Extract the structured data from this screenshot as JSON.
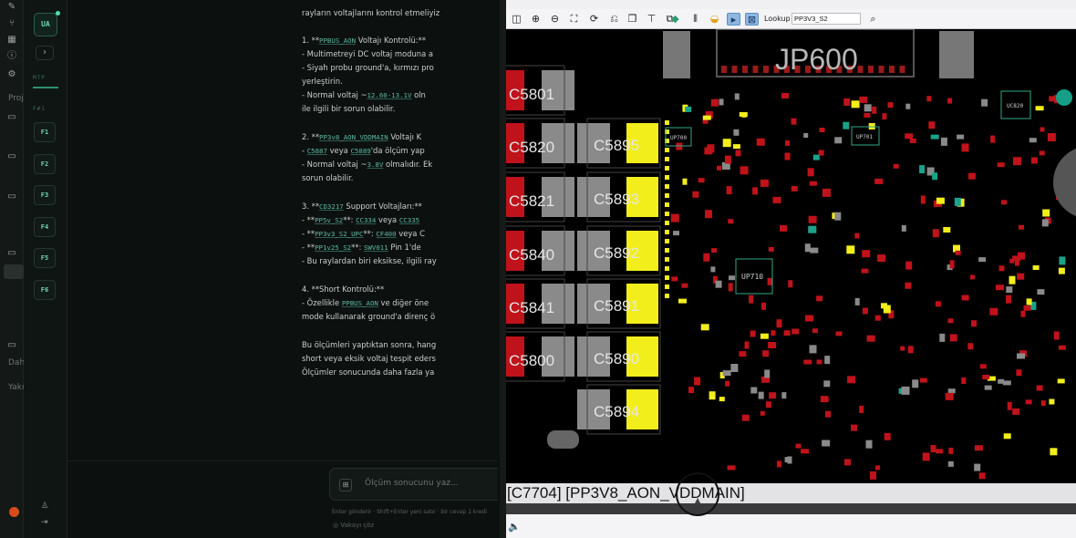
{
  "sys_strip": {
    "labels": [
      "Proj",
      "Dah",
      "Yakı"
    ]
  },
  "fkey_sidebar": {
    "badge": "UA",
    "group_top": "MTP",
    "group_f": "F#1",
    "keys": [
      "F1",
      "F2",
      "F3",
      "F4",
      "F5",
      "F6"
    ]
  },
  "chat": {
    "lines_intro": "rayların voltajlarını kontrol etmeliyiz",
    "s1_title_pre": "1. **",
    "s1_code": "PPBUS_AON",
    "s1_title_post": " Voltajı Kontrolü:**",
    "s1_l1": "- Multimetreyi DC voltaj moduna a",
    "s1_l2": "- Siyah probu ground'a, kırmızı pro",
    "s1_l3": "yerleştirin.",
    "s1_l4_pre": "- Normal voltaj ~",
    "s1_l4_code": "12.60-13.1V",
    "s1_l4_post": " oln",
    "s1_l5": "ile ilgili bir sorun olabilir.",
    "s2_title_pre": "2. **",
    "s2_code": "PP3v8_AON_VDDMAIN",
    "s2_title_post": " Voltajı K",
    "s2_l1_pre": "- ",
    "s2_l1_code1": "C5887",
    "s2_l1_mid": " veya ",
    "s2_l1_code2": "C5889",
    "s2_l1_post": "'da ölçüm yap",
    "s2_l2_pre": "- Normal voltaj ~",
    "s2_l2_code": "3.8V",
    "s2_l2_post": " olmalıdır. Ek",
    "s2_l3": "sorun olabilir.",
    "s3_title_pre": "3. **",
    "s3_code": "CD3217",
    "s3_title_post": " Support Voltajları:**",
    "s3_l1_pre": "- **",
    "s3_l1_code1": "PP5v_S2",
    "s3_l1_mid": "**: ",
    "s3_l1_code2": "CC334",
    "s3_l1_mid2": " veya ",
    "s3_l1_code3": "CC335",
    "s3_l2_pre": "- **",
    "s3_l2_code1": "PP3v3_S2_UPC",
    "s3_l2_mid": "**: ",
    "s3_l2_code2": "CF400",
    "s3_l2_post": " veya C",
    "s3_l3_pre": "- **",
    "s3_l3_code1": "PP1v25_S2",
    "s3_l3_mid": "**: ",
    "s3_l3_code2": "SWV011",
    "s3_l3_post": " Pin 1'de",
    "s3_l4": "- Bu raylardan biri eksikse, ilgili ray",
    "s4_title": "4. **Short Kontrolü:**",
    "s4_l1_pre": "- Özellikle ",
    "s4_l1_code": "PPBUS_AON",
    "s4_l1_post": " ve diğer öne",
    "s4_l2": "mode kullanarak ground'a direnç ö",
    "end_l1": "Bu ölçümleri yaptıktan sonra, hang",
    "end_l2": "short veya eksik voltaj tespit eders",
    "end_l3": "Ölçümler sonucunda daha fazla ya",
    "input_placeholder": "Ölçüm sonucunu yaz...",
    "hint": "Enter gönderir · Shift+Enter yeni satır · bir cevap 1 kredi",
    "hint2": "Vakayı çöz"
  },
  "boardview": {
    "lookup_label": "Lookup",
    "lookup_value": "PP3V3_S2",
    "status": "[C7704] [PP3V8_AON_VDDMAIN]",
    "jp_label": "JP600",
    "components_large": [
      {
        "label": "C5801"
      },
      {
        "label": "C5820"
      },
      {
        "label": "C5821"
      },
      {
        "label": "C5840"
      },
      {
        "label": "C5841"
      },
      {
        "label": "C5800"
      },
      {
        "label": "C5895"
      },
      {
        "label": "C5893"
      },
      {
        "label": "C5892"
      },
      {
        "label": "C5891"
      },
      {
        "label": "C5890"
      },
      {
        "label": "C5894"
      }
    ],
    "components_small": [
      "UC820",
      "UP700",
      "UP701",
      "UP710"
    ]
  },
  "colors": {
    "accent": "#6fd3b2",
    "board_bg": "#000000",
    "pad_red": "#c0121a",
    "pad_yellow": "#f2ee1c",
    "pad_grey": "#8a8a8a"
  }
}
